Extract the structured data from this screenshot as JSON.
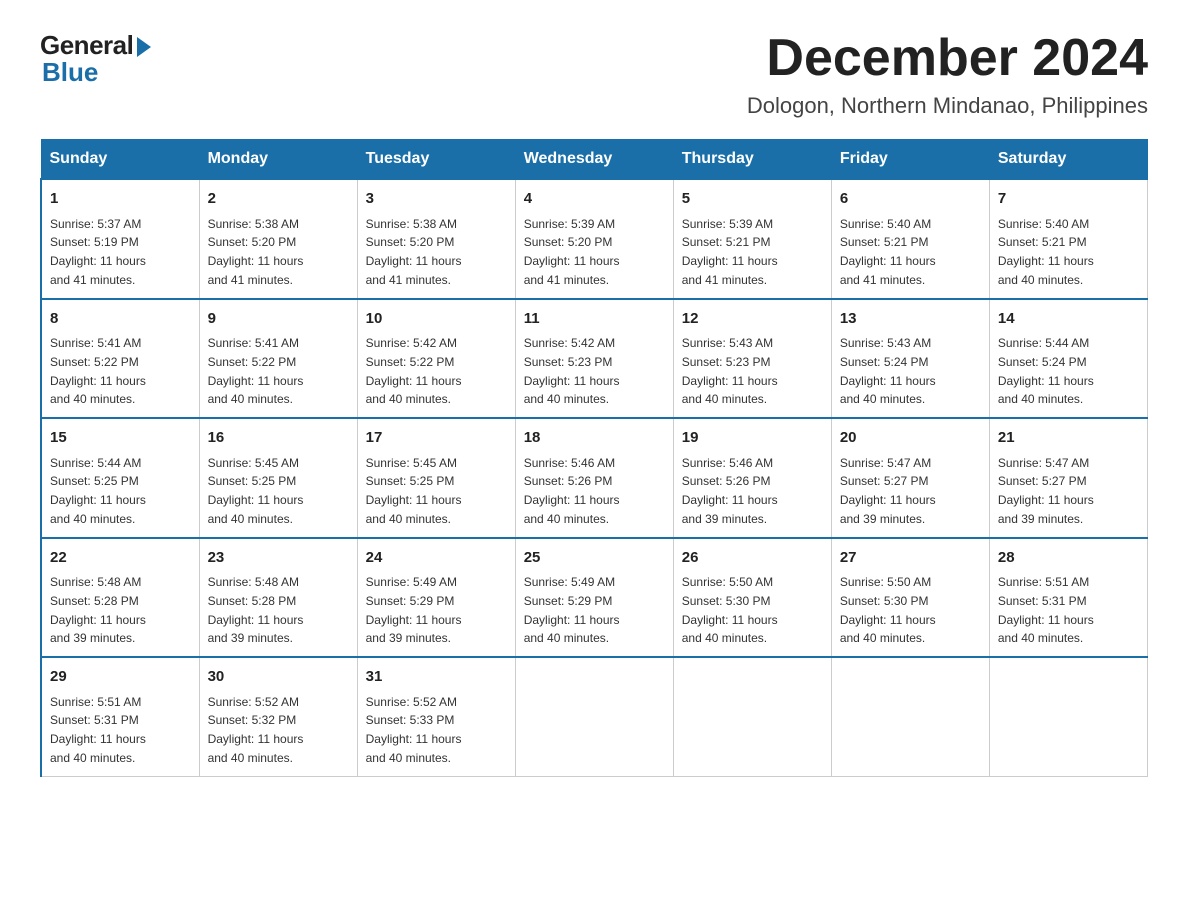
{
  "header": {
    "logo_general": "General",
    "logo_blue": "Blue",
    "month_title": "December 2024",
    "subtitle": "Dologon, Northern Mindanao, Philippines"
  },
  "days_of_week": [
    "Sunday",
    "Monday",
    "Tuesday",
    "Wednesday",
    "Thursday",
    "Friday",
    "Saturday"
  ],
  "weeks": [
    [
      {
        "day": "1",
        "sunrise": "5:37 AM",
        "sunset": "5:19 PM",
        "daylight": "11 hours and 41 minutes."
      },
      {
        "day": "2",
        "sunrise": "5:38 AM",
        "sunset": "5:20 PM",
        "daylight": "11 hours and 41 minutes."
      },
      {
        "day": "3",
        "sunrise": "5:38 AM",
        "sunset": "5:20 PM",
        "daylight": "11 hours and 41 minutes."
      },
      {
        "day": "4",
        "sunrise": "5:39 AM",
        "sunset": "5:20 PM",
        "daylight": "11 hours and 41 minutes."
      },
      {
        "day": "5",
        "sunrise": "5:39 AM",
        "sunset": "5:21 PM",
        "daylight": "11 hours and 41 minutes."
      },
      {
        "day": "6",
        "sunrise": "5:40 AM",
        "sunset": "5:21 PM",
        "daylight": "11 hours and 41 minutes."
      },
      {
        "day": "7",
        "sunrise": "5:40 AM",
        "sunset": "5:21 PM",
        "daylight": "11 hours and 40 minutes."
      }
    ],
    [
      {
        "day": "8",
        "sunrise": "5:41 AM",
        "sunset": "5:22 PM",
        "daylight": "11 hours and 40 minutes."
      },
      {
        "day": "9",
        "sunrise": "5:41 AM",
        "sunset": "5:22 PM",
        "daylight": "11 hours and 40 minutes."
      },
      {
        "day": "10",
        "sunrise": "5:42 AM",
        "sunset": "5:22 PM",
        "daylight": "11 hours and 40 minutes."
      },
      {
        "day": "11",
        "sunrise": "5:42 AM",
        "sunset": "5:23 PM",
        "daylight": "11 hours and 40 minutes."
      },
      {
        "day": "12",
        "sunrise": "5:43 AM",
        "sunset": "5:23 PM",
        "daylight": "11 hours and 40 minutes."
      },
      {
        "day": "13",
        "sunrise": "5:43 AM",
        "sunset": "5:24 PM",
        "daylight": "11 hours and 40 minutes."
      },
      {
        "day": "14",
        "sunrise": "5:44 AM",
        "sunset": "5:24 PM",
        "daylight": "11 hours and 40 minutes."
      }
    ],
    [
      {
        "day": "15",
        "sunrise": "5:44 AM",
        "sunset": "5:25 PM",
        "daylight": "11 hours and 40 minutes."
      },
      {
        "day": "16",
        "sunrise": "5:45 AM",
        "sunset": "5:25 PM",
        "daylight": "11 hours and 40 minutes."
      },
      {
        "day": "17",
        "sunrise": "5:45 AM",
        "sunset": "5:25 PM",
        "daylight": "11 hours and 40 minutes."
      },
      {
        "day": "18",
        "sunrise": "5:46 AM",
        "sunset": "5:26 PM",
        "daylight": "11 hours and 40 minutes."
      },
      {
        "day": "19",
        "sunrise": "5:46 AM",
        "sunset": "5:26 PM",
        "daylight": "11 hours and 39 minutes."
      },
      {
        "day": "20",
        "sunrise": "5:47 AM",
        "sunset": "5:27 PM",
        "daylight": "11 hours and 39 minutes."
      },
      {
        "day": "21",
        "sunrise": "5:47 AM",
        "sunset": "5:27 PM",
        "daylight": "11 hours and 39 minutes."
      }
    ],
    [
      {
        "day": "22",
        "sunrise": "5:48 AM",
        "sunset": "5:28 PM",
        "daylight": "11 hours and 39 minutes."
      },
      {
        "day": "23",
        "sunrise": "5:48 AM",
        "sunset": "5:28 PM",
        "daylight": "11 hours and 39 minutes."
      },
      {
        "day": "24",
        "sunrise": "5:49 AM",
        "sunset": "5:29 PM",
        "daylight": "11 hours and 39 minutes."
      },
      {
        "day": "25",
        "sunrise": "5:49 AM",
        "sunset": "5:29 PM",
        "daylight": "11 hours and 40 minutes."
      },
      {
        "day": "26",
        "sunrise": "5:50 AM",
        "sunset": "5:30 PM",
        "daylight": "11 hours and 40 minutes."
      },
      {
        "day": "27",
        "sunrise": "5:50 AM",
        "sunset": "5:30 PM",
        "daylight": "11 hours and 40 minutes."
      },
      {
        "day": "28",
        "sunrise": "5:51 AM",
        "sunset": "5:31 PM",
        "daylight": "11 hours and 40 minutes."
      }
    ],
    [
      {
        "day": "29",
        "sunrise": "5:51 AM",
        "sunset": "5:31 PM",
        "daylight": "11 hours and 40 minutes."
      },
      {
        "day": "30",
        "sunrise": "5:52 AM",
        "sunset": "5:32 PM",
        "daylight": "11 hours and 40 minutes."
      },
      {
        "day": "31",
        "sunrise": "5:52 AM",
        "sunset": "5:33 PM",
        "daylight": "11 hours and 40 minutes."
      },
      null,
      null,
      null,
      null
    ]
  ],
  "labels": {
    "sunrise": "Sunrise:",
    "sunset": "Sunset:",
    "daylight": "Daylight:"
  }
}
